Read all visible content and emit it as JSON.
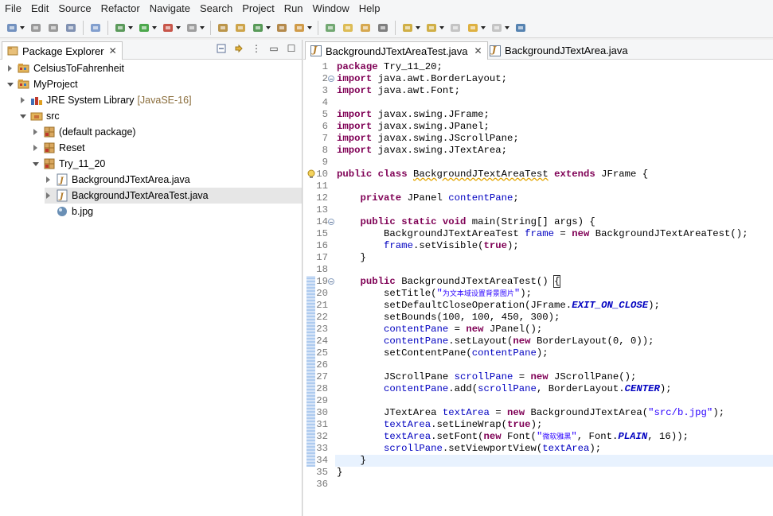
{
  "menu": [
    "File",
    "Edit",
    "Source",
    "Refactor",
    "Navigate",
    "Search",
    "Project",
    "Run",
    "Window",
    "Help"
  ],
  "toolbar_icons": [
    "new-icon",
    "save-icon",
    "save-all-icon",
    "print-icon",
    "skip-breakpoints-icon",
    "debug-icon",
    "run-icon",
    "coverage-icon",
    "external-tools-icon",
    "new-java-project-icon",
    "new-java-package-icon",
    "new-java-class-icon",
    "open-type-icon",
    "search-icon",
    "task-icon",
    "mark-occurrences-icon",
    "toggle-block-icon",
    "show-whitespace-icon",
    "next-annotation-icon",
    "prev-annotation-icon",
    "last-edit-icon",
    "back-icon",
    "forward-icon",
    "pin-editor-icon"
  ],
  "package_explorer": {
    "title": "Package Explorer",
    "tree": [
      {
        "label": "CelsiusToFahrenheit",
        "depth": 0,
        "state": "collapsed",
        "icon": "project-icon"
      },
      {
        "label": "MyProject",
        "depth": 0,
        "state": "expanded",
        "icon": "project-icon"
      },
      {
        "label": "JRE System Library",
        "extra": "[JavaSE-16]",
        "depth": 1,
        "state": "collapsed",
        "icon": "library-icon"
      },
      {
        "label": "src",
        "depth": 1,
        "state": "expanded",
        "icon": "source-folder-icon"
      },
      {
        "label": "(default package)",
        "depth": 2,
        "state": "collapsed",
        "icon": "package-icon"
      },
      {
        "label": "Reset",
        "depth": 2,
        "state": "collapsed",
        "icon": "package-icon"
      },
      {
        "label": "Try_11_20",
        "depth": 2,
        "state": "expanded",
        "icon": "package-icon"
      },
      {
        "label": "BackgroundJTextArea.java",
        "depth": 3,
        "state": "collapsed",
        "icon": "java-file-icon"
      },
      {
        "label": "BackgroundJTextAreaTest.java",
        "depth": 3,
        "state": "collapsed",
        "icon": "java-file-icon",
        "selected": true
      },
      {
        "label": "b.jpg",
        "depth": 3,
        "state": "leaf",
        "icon": "image-file-icon"
      }
    ]
  },
  "editor": {
    "tabs": [
      {
        "label": "BackgroundJTextAreaTest.java",
        "active": true
      },
      {
        "label": "BackgroundJTextArea.java",
        "active": false
      }
    ],
    "lines": [
      {
        "n": "1",
        "t": "package Try_11_20;"
      },
      {
        "n": "2",
        "t": "import java.awt.BorderLayout;"
      },
      {
        "n": "3",
        "t": "import java.awt.Font;"
      },
      {
        "n": "4",
        "t": ""
      },
      {
        "n": "5",
        "t": "import javax.swing.JFrame;"
      },
      {
        "n": "6",
        "t": "import javax.swing.JPanel;"
      },
      {
        "n": "7",
        "t": "import javax.swing.JScrollPane;"
      },
      {
        "n": "8",
        "t": "import javax.swing.JTextArea;"
      },
      {
        "n": "9",
        "t": ""
      },
      {
        "n": "10",
        "t": "public class BackgroundJTextAreaTest extends JFrame {"
      },
      {
        "n": "11",
        "t": ""
      },
      {
        "n": "12",
        "t": "    private JPanel contentPane;"
      },
      {
        "n": "13",
        "t": ""
      },
      {
        "n": "14",
        "t": "    public static void main(String[] args) {"
      },
      {
        "n": "15",
        "t": "        BackgroundJTextAreaTest frame = new BackgroundJTextAreaTest();"
      },
      {
        "n": "16",
        "t": "        frame.setVisible(true);"
      },
      {
        "n": "17",
        "t": "    }"
      },
      {
        "n": "18",
        "t": ""
      },
      {
        "n": "19",
        "t": "    public BackgroundJTextAreaTest() {"
      },
      {
        "n": "20",
        "t": "        setTitle(\"为文本域设置背景图片\");"
      },
      {
        "n": "21",
        "t": "        setDefaultCloseOperation(JFrame.EXIT_ON_CLOSE);"
      },
      {
        "n": "22",
        "t": "        setBounds(100, 100, 450, 300);"
      },
      {
        "n": "23",
        "t": "        contentPane = new JPanel();"
      },
      {
        "n": "24",
        "t": "        contentPane.setLayout(new BorderLayout(0, 0));"
      },
      {
        "n": "25",
        "t": "        setContentPane(contentPane);"
      },
      {
        "n": "26",
        "t": ""
      },
      {
        "n": "27",
        "t": "        JScrollPane scrollPane = new JScrollPane();"
      },
      {
        "n": "28",
        "t": "        contentPane.add(scrollPane, BorderLayout.CENTER);"
      },
      {
        "n": "29",
        "t": ""
      },
      {
        "n": "30",
        "t": "        JTextArea textArea = new BackgroundJTextArea(\"src/b.jpg\");"
      },
      {
        "n": "31",
        "t": "        textArea.setLineWrap(true);"
      },
      {
        "n": "32",
        "t": "        textArea.setFont(new Font(\"微软雅黑\", Font.PLAIN, 16));"
      },
      {
        "n": "33",
        "t": "        scrollPane.setViewportView(textArea);"
      },
      {
        "n": "34",
        "t": "    }"
      },
      {
        "n": "35",
        "t": "}"
      },
      {
        "n": "36",
        "t": ""
      }
    ],
    "folded_lines": [
      "2",
      "14",
      "19"
    ],
    "warning_line": "10",
    "current_line": "34",
    "quick_diff_ranges": [
      [
        "19",
        "34"
      ]
    ]
  }
}
